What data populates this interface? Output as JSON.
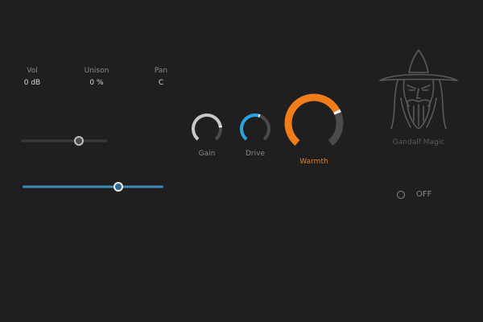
{
  "params": [
    {
      "name": "Vol",
      "value": "0 dB"
    },
    {
      "name": "Unison",
      "value": "0 %"
    },
    {
      "name": "Pan",
      "value": "C"
    }
  ],
  "sliders": [
    {
      "id": "slider-1",
      "level": 0.67,
      "accent": "#bdbdbd"
    },
    {
      "id": "slider-2",
      "level": 0.68,
      "accent": "#3d8db8"
    }
  ],
  "knobs": [
    {
      "id": "gain",
      "label": "Gain",
      "color": "#c8c8c8",
      "level": 0.78
    },
    {
      "id": "drive",
      "label": "Drive",
      "color": "#2aa3e0",
      "level": 0.55
    },
    {
      "id": "warmth",
      "label": "Warmth",
      "color": "#f07c1a",
      "level": 0.72
    }
  ],
  "wizard": {
    "icon": "gandalf-wizard-icon",
    "caption": "Gandalf Magic"
  },
  "toggle": {
    "state_label": "OFF",
    "on": false
  },
  "colors": {
    "background": "#1f1f1f",
    "track_inactive": "#4a4a4a",
    "warmth_accent": "#f07c1a",
    "drive_accent": "#2aa3e0"
  }
}
